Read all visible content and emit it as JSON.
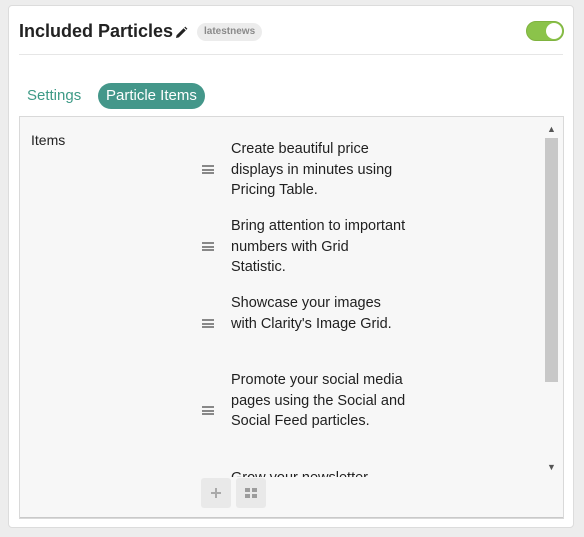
{
  "header": {
    "title": "Included Particles",
    "badge": "latestnews",
    "enabled": true
  },
  "tabs": [
    {
      "label": "Settings",
      "active": false
    },
    {
      "label": "Particle Items",
      "active": true
    }
  ],
  "items_section": {
    "label": "Items",
    "items": [
      {
        "text": "Create beautiful price displays in minutes using Pricing Table."
      },
      {
        "text": "Bring attention to important numbers with Grid Statistic."
      },
      {
        "text": "Showcase your images with Clarity's Image Grid."
      },
      {
        "text": "Promote your social media pages using the Social and Social Feed particles."
      },
      {
        "text": "Grow your newsletter"
      }
    ]
  },
  "colors": {
    "accent": "#44978a",
    "toggle_on": "#8bc34a"
  },
  "icons": {
    "edit": "pencil-icon",
    "drag": "drag-handle-icon",
    "add": "plus-icon",
    "layout": "grid-icon"
  }
}
